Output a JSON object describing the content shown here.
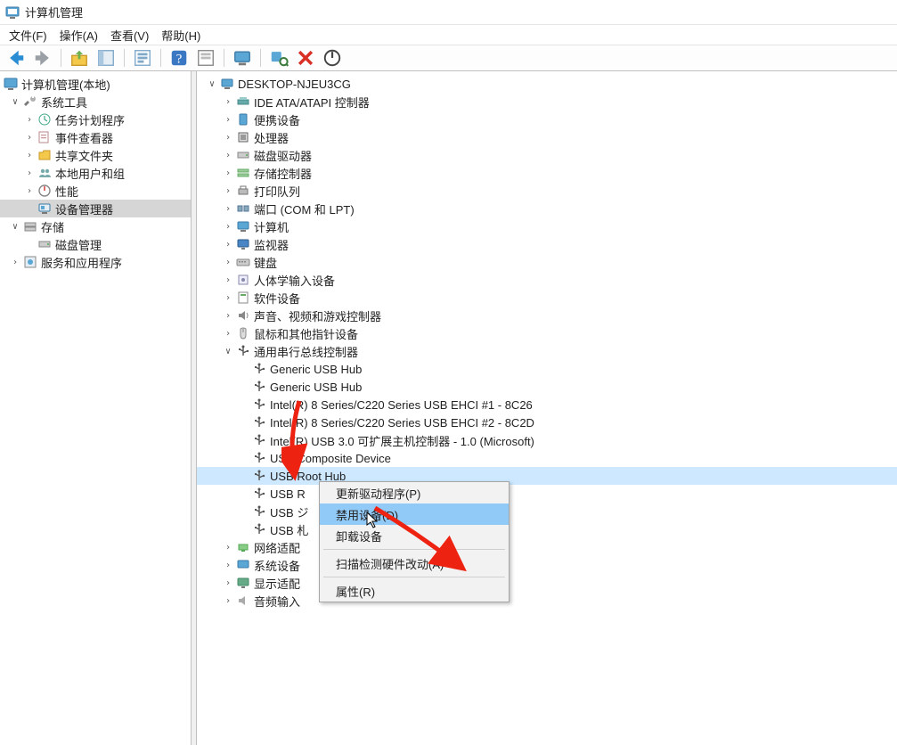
{
  "window": {
    "title": "计算机管理"
  },
  "menu": {
    "file": "文件(F)",
    "action": "操作(A)",
    "view": "查看(V)",
    "help": "帮助(H)"
  },
  "left_tree": {
    "root": "计算机管理(本地)",
    "sys_tools": "系统工具",
    "task_sched": "任务计划程序",
    "event_viewer": "事件查看器",
    "shared_folders": "共享文件夹",
    "local_users": "本地用户和组",
    "perf": "性能",
    "dev_mgr": "设备管理器",
    "storage": "存储",
    "disk_mgmt": "磁盘管理",
    "services": "服务和应用程序"
  },
  "right_tree": {
    "computer": "DESKTOP-NJEU3CG",
    "ide": "IDE ATA/ATAPI 控制器",
    "portable": "便携设备",
    "cpu": "处理器",
    "disk_drives": "磁盘驱动器",
    "storage_ctrl": "存储控制器",
    "print_queues": "打印队列",
    "ports": "端口 (COM 和 LPT)",
    "computers": "计算机",
    "monitors": "监视器",
    "keyboards": "键盘",
    "hid": "人体学输入设备",
    "software_dev": "软件设备",
    "sound": "声音、视频和游戏控制器",
    "mice": "鼠标和其他指针设备",
    "usb_ctrl": "通用串行总线控制器",
    "usb_children": {
      "g1": "Generic USB Hub",
      "g2": "Generic USB Hub",
      "i1": "Intel(R) 8 Series/C220 Series USB EHCI #1 - 8C26",
      "i2": "Intel(R) 8 Series/C220 Series USB EHCI #2 - 8C2D",
      "i3": "Intel(R) USB 3.0 可扩展主机控制器 - 1.0 (Microsoft)",
      "comp": "USB Composite Device",
      "root_hub": "USB Root Hub",
      "usb_r": "USB R",
      "usb_j": "USB ジ",
      "usb_k": "USB 札"
    },
    "net": "网络适配",
    "sys_dev": "系统设备",
    "display": "显示适配",
    "audio_in": "音频输入"
  },
  "context_menu": {
    "update_driver": "更新驱动程序(P)",
    "disable": "禁用设备(D)",
    "uninstall": "卸载设备",
    "scan": "扫描检测硬件改动(A)",
    "properties": "属性(R)"
  }
}
